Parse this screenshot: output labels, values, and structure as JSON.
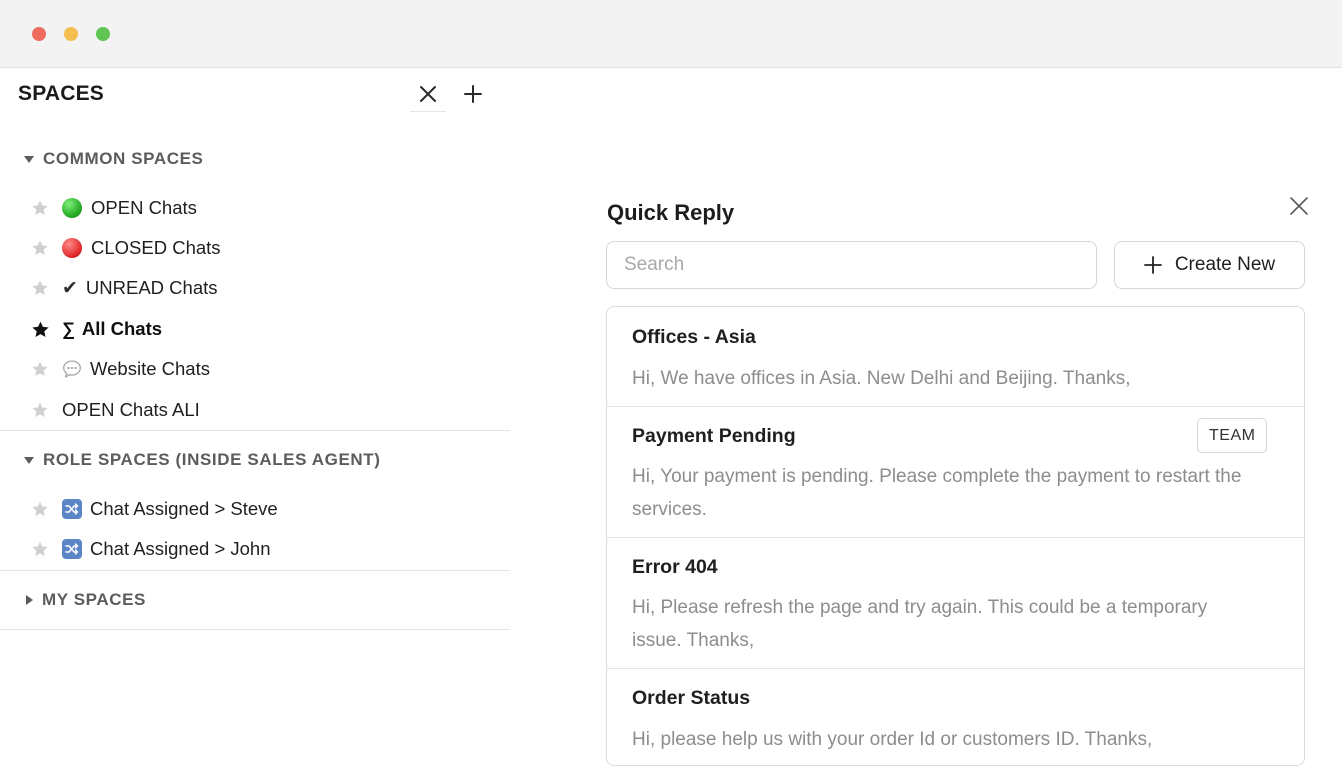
{
  "window": {
    "controls": [
      "close",
      "minimize",
      "zoom"
    ]
  },
  "sidebar": {
    "title": "SPACES",
    "close_icon": "close-icon",
    "add_icon": "plus-icon",
    "sections": [
      {
        "label": "COMMON SPACES",
        "expanded": true,
        "items": [
          {
            "icon": "green-circle",
            "label": "OPEN Chats",
            "starred": false
          },
          {
            "icon": "red-circle",
            "label": "CLOSED Chats",
            "starred": false
          },
          {
            "icon": "checkmark",
            "label": "UNREAD Chats",
            "starred": false
          },
          {
            "icon": "sigma",
            "label": "All Chats",
            "starred": true
          },
          {
            "icon": "speech-bubble",
            "label": "Website Chats",
            "starred": false
          },
          {
            "icon": "",
            "label": "OPEN Chats ALI",
            "starred": false
          }
        ]
      },
      {
        "label": "ROLE SPACES (INSIDE SALES AGENT)",
        "expanded": true,
        "items": [
          {
            "icon": "shuffle",
            "label": "Chat Assigned > Steve",
            "starred": false
          },
          {
            "icon": "shuffle",
            "label": "Chat Assigned > John",
            "starred": false
          }
        ]
      },
      {
        "label": "MY SPACES",
        "expanded": false,
        "items": []
      }
    ],
    "glyphs": {
      "sigma": "∑",
      "check": "✔"
    }
  },
  "quick_reply": {
    "title": "Quick Reply",
    "search_placeholder": "Search",
    "create_label": "Create New",
    "replies": [
      {
        "title": "Offices - Asia",
        "body": "Hi, We have offices in Asia. New Delhi and Beijing. Thanks,",
        "badge": ""
      },
      {
        "title": "Payment Pending",
        "body": "Hi, Your payment is pending. Please complete the payment to restart the services.",
        "badge": "TEAM"
      },
      {
        "title": "Error 404",
        "body": "Hi, Please refresh the page and try again. This could be a temporary issue. Thanks,",
        "badge": ""
      },
      {
        "title": "Order Status",
        "body": "Hi, please help us with your order Id or customers ID. Thanks,",
        "badge": ""
      }
    ]
  },
  "colors": {
    "traffic_red": "#ec6a5e",
    "traffic_yellow": "#f4bf4f",
    "traffic_green": "#61c554",
    "muted_text": "#8d8d8d",
    "star_inactive": "#d0d0d0"
  }
}
